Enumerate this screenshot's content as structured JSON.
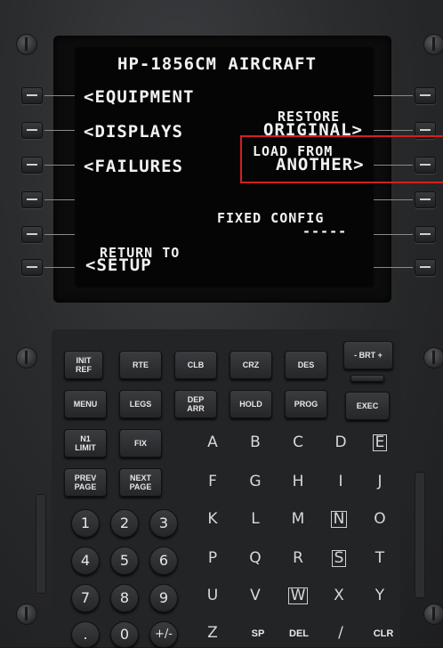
{
  "screen": {
    "title": "HP-1856CM AIRCRAFT",
    "left": [
      "<EQUIPMENT",
      "<DISPLAYS",
      "<FAILURES"
    ],
    "restore_small": "RESTORE",
    "restore_big": "ORIGINAL>",
    "load_small": "LOAD FROM",
    "load_big": "ANOTHER>",
    "fixed_config": "FIXED CONFIG",
    "fixed_value": "-----",
    "return_small": "RETURN TO",
    "return_big": "<SETUP"
  },
  "keys": {
    "init_ref": "INIT REF",
    "rte": "RTE",
    "clb": "CLB",
    "crz": "CRZ",
    "des": "DES",
    "brt": "- BRT +",
    "menu": "MENU",
    "legs": "LEGS",
    "dep_arr": "DEP ARR",
    "hold": "HOLD",
    "prog": "PROG",
    "exec": "EXEC",
    "n1_limit": "N1 LIMIT",
    "fix": "FIX",
    "prev_page": "PREV PAGE",
    "next_page": "NEXT PAGE",
    "letters": [
      "A",
      "B",
      "C",
      "D",
      "E",
      "F",
      "G",
      "H",
      "I",
      "J",
      "K",
      "L",
      "M",
      "N",
      "O",
      "P",
      "Q",
      "R",
      "S",
      "T",
      "U",
      "V",
      "W",
      "X",
      "Y",
      "Z",
      "SP",
      "DEL",
      "/",
      "CLR"
    ],
    "digits": [
      "1",
      "2",
      "3",
      "4",
      "5",
      "6",
      "7",
      "8",
      "9",
      ".",
      "0",
      "+/-"
    ]
  }
}
